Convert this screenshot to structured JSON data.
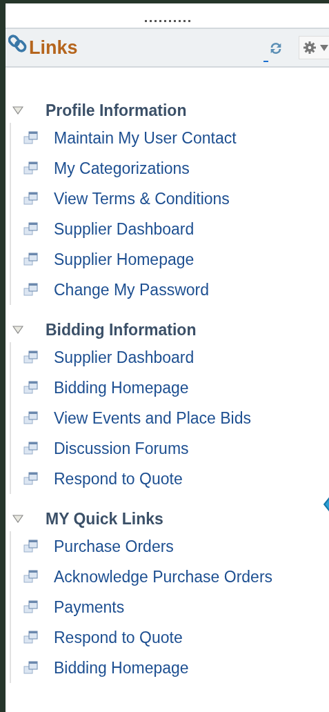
{
  "panel": {
    "title": "Links"
  },
  "sections": [
    {
      "title": "Profile Information",
      "expanded": true,
      "items": [
        "Maintain My User Contact",
        "My Categorizations",
        "View Terms & Conditions",
        "Supplier Dashboard",
        "Supplier Homepage",
        "Change My Password"
      ]
    },
    {
      "title": "Bidding Information",
      "expanded": true,
      "items": [
        "Supplier Dashboard",
        "Bidding Homepage",
        "View Events and Place Bids",
        "Discussion Forums",
        "Respond to Quote"
      ]
    },
    {
      "title": "MY Quick Links",
      "expanded": true,
      "items": [
        "Purchase Orders",
        "Acknowledge Purchase Orders",
        "Payments",
        "Respond to Quote",
        "Bidding Homepage"
      ]
    }
  ]
}
